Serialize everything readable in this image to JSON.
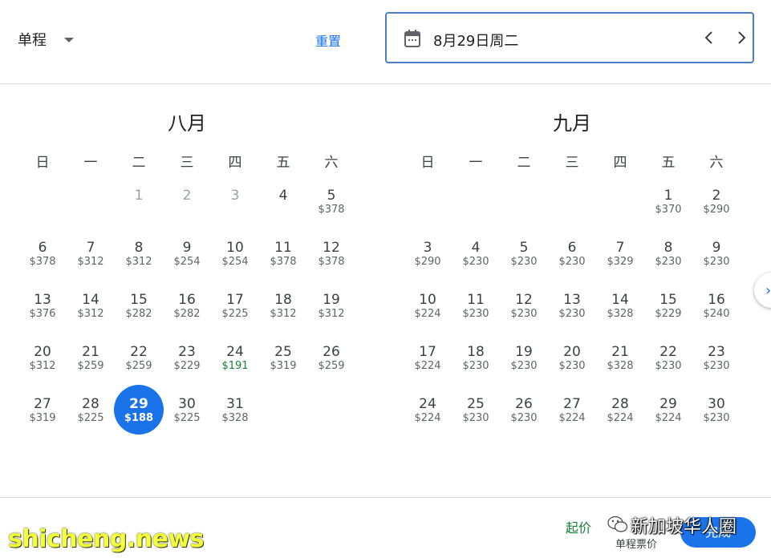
{
  "header": {
    "trip_type": "单程",
    "reset_label": "重置",
    "date_value": "8月29日周二"
  },
  "months": [
    {
      "title": "八月",
      "weekdays": [
        "日",
        "一",
        "二",
        "三",
        "四",
        "五",
        "六"
      ],
      "lead_blanks": 2,
      "days": [
        {
          "d": "1",
          "p": "",
          "past": true
        },
        {
          "d": "2",
          "p": "",
          "past": true
        },
        {
          "d": "3",
          "p": "",
          "past": true
        },
        {
          "d": "4",
          "p": ""
        },
        {
          "d": "5",
          "p": "$378"
        },
        {
          "d": "6",
          "p": "$378"
        },
        {
          "d": "7",
          "p": "$312"
        },
        {
          "d": "8",
          "p": "$312"
        },
        {
          "d": "9",
          "p": "$254"
        },
        {
          "d": "10",
          "p": "$254"
        },
        {
          "d": "11",
          "p": "$378"
        },
        {
          "d": "12",
          "p": "$378"
        },
        {
          "d": "13",
          "p": "$376"
        },
        {
          "d": "14",
          "p": "$312"
        },
        {
          "d": "15",
          "p": "$282"
        },
        {
          "d": "16",
          "p": "$282"
        },
        {
          "d": "17",
          "p": "$225"
        },
        {
          "d": "18",
          "p": "$312"
        },
        {
          "d": "19",
          "p": "$312"
        },
        {
          "d": "20",
          "p": "$312"
        },
        {
          "d": "21",
          "p": "$259"
        },
        {
          "d": "22",
          "p": "$259"
        },
        {
          "d": "23",
          "p": "$229"
        },
        {
          "d": "24",
          "p": "$191",
          "low": true
        },
        {
          "d": "25",
          "p": "$319"
        },
        {
          "d": "26",
          "p": "$259"
        },
        {
          "d": "27",
          "p": "$319"
        },
        {
          "d": "28",
          "p": "$225"
        },
        {
          "d": "29",
          "p": "$188",
          "selected": true
        },
        {
          "d": "30",
          "p": "$225"
        },
        {
          "d": "31",
          "p": "$328"
        }
      ]
    },
    {
      "title": "九月",
      "weekdays": [
        "日",
        "一",
        "二",
        "三",
        "四",
        "五",
        "六"
      ],
      "lead_blanks": 5,
      "days": [
        {
          "d": "1",
          "p": "$370"
        },
        {
          "d": "2",
          "p": "$290"
        },
        {
          "d": "3",
          "p": "$290"
        },
        {
          "d": "4",
          "p": "$230"
        },
        {
          "d": "5",
          "p": "$230"
        },
        {
          "d": "6",
          "p": "$230"
        },
        {
          "d": "7",
          "p": "$329"
        },
        {
          "d": "8",
          "p": "$230"
        },
        {
          "d": "9",
          "p": "$230"
        },
        {
          "d": "10",
          "p": "$224"
        },
        {
          "d": "11",
          "p": "$230"
        },
        {
          "d": "12",
          "p": "$230"
        },
        {
          "d": "13",
          "p": "$230"
        },
        {
          "d": "14",
          "p": "$328"
        },
        {
          "d": "15",
          "p": "$229"
        },
        {
          "d": "16",
          "p": "$240"
        },
        {
          "d": "17",
          "p": "$224"
        },
        {
          "d": "18",
          "p": "$230"
        },
        {
          "d": "19",
          "p": "$230"
        },
        {
          "d": "20",
          "p": "$230"
        },
        {
          "d": "21",
          "p": "$328"
        },
        {
          "d": "22",
          "p": "$230"
        },
        {
          "d": "23",
          "p": "$230"
        },
        {
          "d": "24",
          "p": "$224"
        },
        {
          "d": "25",
          "p": "$230"
        },
        {
          "d": "26",
          "p": "$230"
        },
        {
          "d": "27",
          "p": "$224"
        },
        {
          "d": "28",
          "p": "$224"
        },
        {
          "d": "29",
          "p": "$224"
        },
        {
          "d": "30",
          "p": "$230"
        }
      ]
    }
  ],
  "footer": {
    "legend_low": "起价",
    "legend_note": "单程票价",
    "done_label": "完成"
  },
  "watermarks": {
    "wechat_text": "新加坡华人圈",
    "site_text": "shicheng.news"
  },
  "colors": {
    "accent": "#1a73e8",
    "low_price": "#188038"
  }
}
